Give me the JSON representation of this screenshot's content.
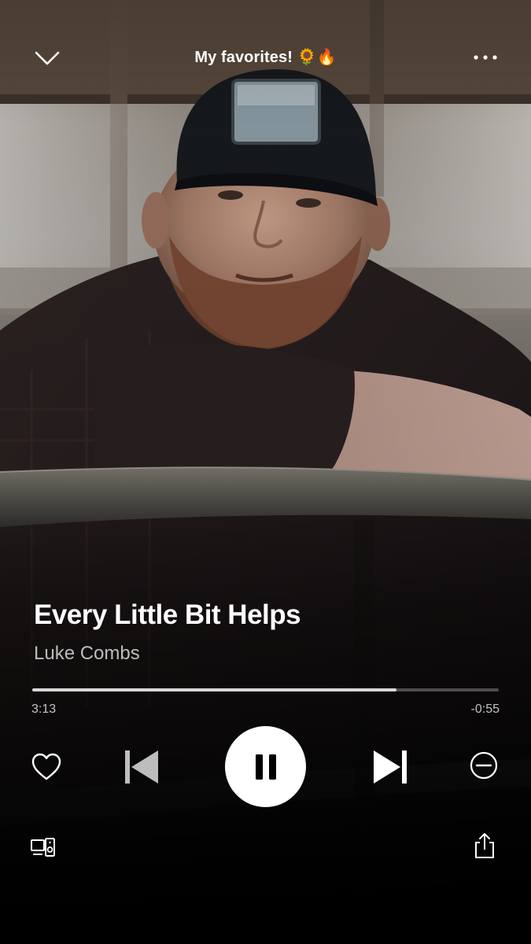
{
  "header": {
    "playlist_title": "My favorites! 🌻🔥",
    "collapse_icon": "chevron-down-icon",
    "more_icon": "more-horizontal-icon"
  },
  "track": {
    "title": "Every Little Bit Helps",
    "artist": "Luke Combs"
  },
  "playback": {
    "elapsed": "3:13",
    "remaining": "-0:55",
    "progress_fraction": 0.78,
    "state": "playing"
  },
  "controls": {
    "like_icon": "heart-icon",
    "previous_icon": "skip-previous-icon",
    "pause_icon": "pause-icon",
    "next_icon": "skip-next-icon",
    "hide_icon": "minus-circle-icon",
    "devices_icon": "devices-icon",
    "share_icon": "share-icon"
  },
  "colors": {
    "accent": "#ffffff",
    "background": "#000000",
    "secondary_text": "#b8b8b8"
  }
}
